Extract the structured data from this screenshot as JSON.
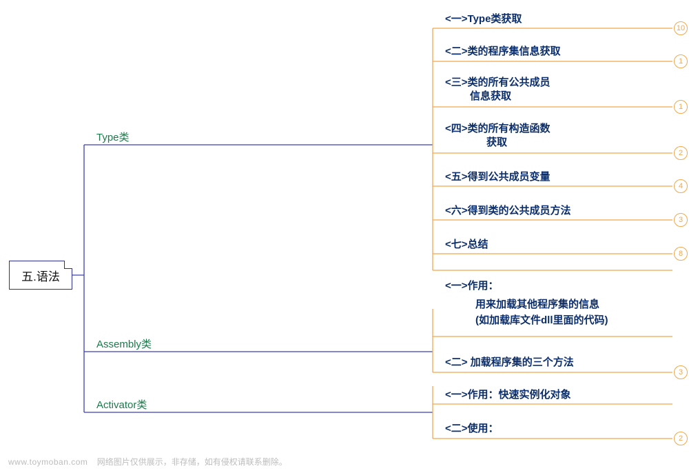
{
  "root": {
    "title": "五.语法"
  },
  "branches": [
    {
      "id": "type",
      "label": "Type类"
    },
    {
      "id": "assembly",
      "label": "Assembly类"
    },
    {
      "id": "activator",
      "label": "Activator类"
    }
  ],
  "leaves": {
    "t1": {
      "text": "<一>Type类获取",
      "badge": "10"
    },
    "t2": {
      "text": "<二>类的程序集信息获取",
      "badge": "1"
    },
    "t3": {
      "line1": "<三>类的所有公共成员",
      "line2": "信息获取",
      "badge": "1"
    },
    "t4": {
      "line1": "<四>类的所有构造函数",
      "line2": "获取",
      "badge": "2"
    },
    "t5": {
      "text": "<五>得到公共成员变量",
      "badge": "4"
    },
    "t6": {
      "text": "<六>得到类的公共成员方法",
      "badge": "3"
    },
    "t7": {
      "text": "<七>总结",
      "badge": "8"
    },
    "a1": {
      "line1": "<一>作用：",
      "line2": "用来加载其他程序集的信息",
      "line3": "(如加载库文件dll里面的代码)"
    },
    "a2": {
      "text": "<二>  加载程序集的三个方法",
      "badge": "3"
    },
    "v1": {
      "text": "<一>作用：快速实例化对象"
    },
    "v2": {
      "text": "<二>使用：",
      "badge": "2"
    }
  },
  "watermark": {
    "site": "www.toymoban.com",
    "note": "网络图片仅供展示，非存储，如有侵权请联系删除。"
  }
}
